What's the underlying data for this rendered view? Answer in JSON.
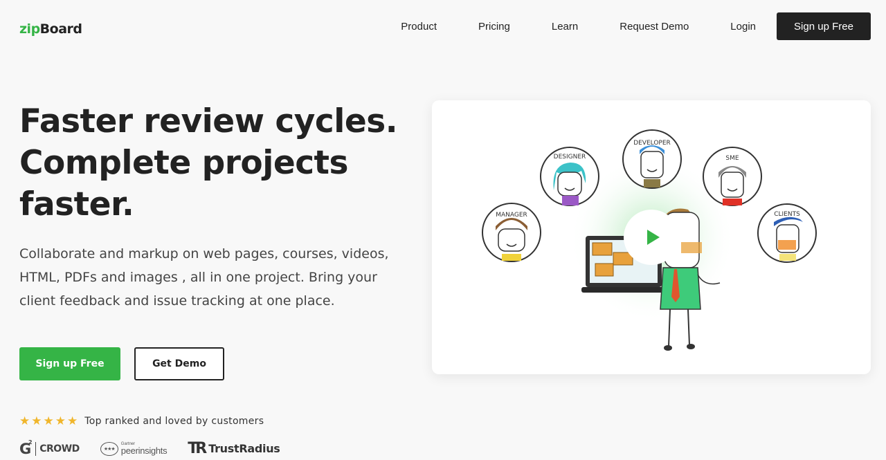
{
  "brand": {
    "prefix": "zip",
    "suffix": "Board",
    "accent_color": "#35b446"
  },
  "nav": {
    "links": [
      "Product",
      "Pricing",
      "Learn",
      "Request Demo",
      "Login"
    ],
    "cta": "Sign up Free"
  },
  "hero": {
    "title": "Faster review cycles. Complete projects faster.",
    "description": "Collaborate and markup on web pages, courses, videos, HTML, PDFs and images , all in one project. Bring your client feedback and issue tracking at one place.",
    "primary_button": "Sign up Free",
    "secondary_button": "Get Demo"
  },
  "rating": {
    "stars": 5,
    "text": "Top ranked and loved by customers"
  },
  "badges": {
    "g2": {
      "mark": "G",
      "sup": "2",
      "text": "CROWD"
    },
    "gartner": {
      "small": "Gartner",
      "big": "peerinsights",
      "stars": "★★★"
    },
    "trustradius": {
      "mark": "TR",
      "text": "TrustRadius"
    }
  },
  "video": {
    "roles": [
      "MANAGER",
      "DESIGNER",
      "DEVELOPER",
      "SME",
      "CLIENTS"
    ],
    "play_icon": "play-icon"
  }
}
